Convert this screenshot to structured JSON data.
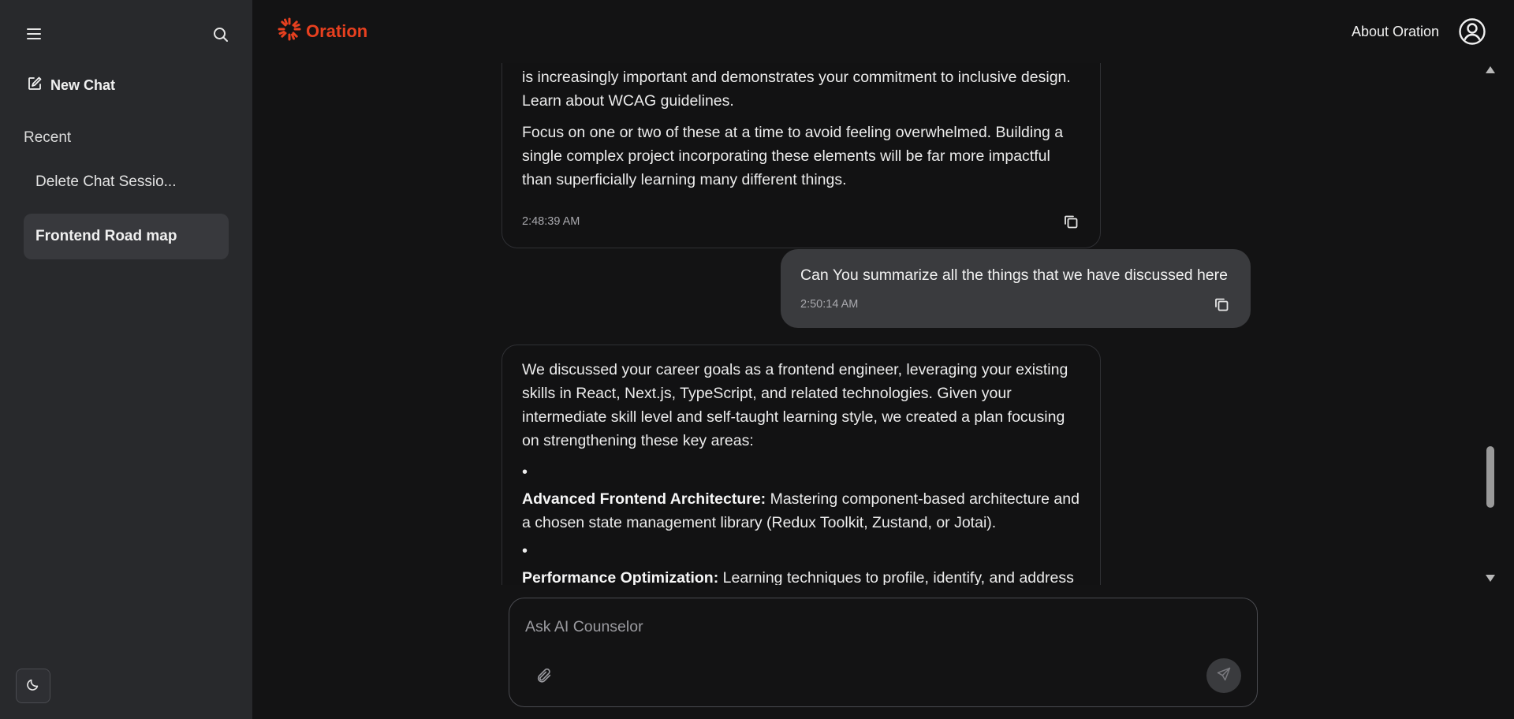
{
  "sidebar": {
    "menu_icon": "hamburger-menu-icon",
    "search_icon": "search-icon",
    "new_chat_label": "New Chat",
    "recent_label": "Recent",
    "items": [
      {
        "label": "Delete Chat Sessio..."
      },
      {
        "label": "Frontend Road map"
      }
    ],
    "theme_icon": "moon-icon"
  },
  "header": {
    "logo_text": "Oration",
    "about_label": "About Oration",
    "profile_icon": "user-circle-icon"
  },
  "messages": [
    {
      "role": "ai",
      "paragraphs": [
        "is increasingly important and demonstrates your commitment to inclusive design. Learn about WCAG guidelines.",
        "Focus on one or two of these at a time to avoid feeling overwhelmed. Building a single complex project incorporating these elements will be far more impactful than superficially learning many different things."
      ],
      "timestamp": "2:48:39 AM"
    },
    {
      "role": "user",
      "text": "Can You summarize all the things that we have discussed here",
      "timestamp": "2:50:14 AM"
    },
    {
      "role": "ai",
      "intro": "We discussed your career goals as a frontend engineer, leveraging your existing skills in React, Next.js, TypeScript, and related technologies. Given your intermediate skill level and self-taught learning style, we created a plan focusing on strengthening these key areas:",
      "bullets": [
        {
          "title": "Advanced Frontend Architecture:",
          "text": " Mastering component-based architecture and a chosen state management library (Redux Toolkit, Zustand, or Jotai)."
        },
        {
          "title": "Performance Optimization:",
          "text": " Learning techniques to profile, identify, and address"
        }
      ]
    }
  ],
  "composer": {
    "placeholder": "Ask AI Counselor",
    "value": ""
  },
  "colors": {
    "accent": "#e8401f",
    "sidebar_bg": "#28292c",
    "main_bg": "#131314",
    "user_bubble": "#3a3b3e"
  }
}
